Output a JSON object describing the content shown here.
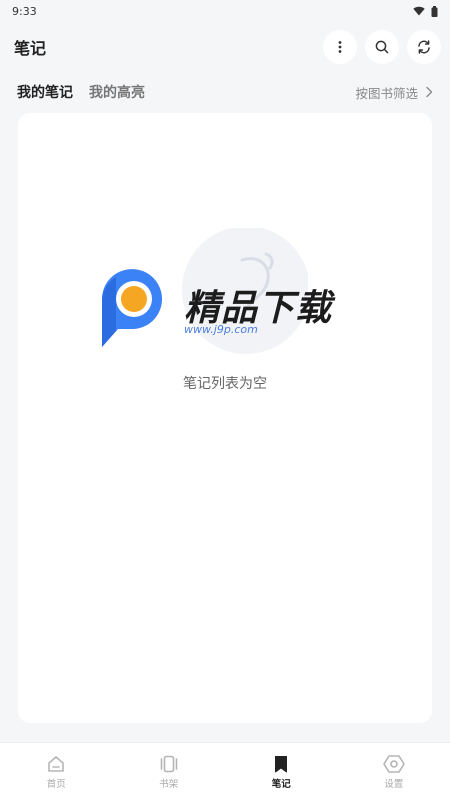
{
  "status_bar": {
    "time": "9:33"
  },
  "header": {
    "title": "笔记"
  },
  "tabs": [
    {
      "label": "我的笔记",
      "active": true
    },
    {
      "label": "我的高亮",
      "active": false
    }
  ],
  "filter": {
    "label": "按图书筛选"
  },
  "empty": {
    "message": "笔记列表为空"
  },
  "watermark": {
    "text": "精品下载",
    "url": "www.j9p.com"
  },
  "bottom_nav": [
    {
      "label": "首页",
      "icon": "home-icon",
      "active": false
    },
    {
      "label": "书架",
      "icon": "bookshelf-icon",
      "active": false
    },
    {
      "label": "笔记",
      "icon": "bookmark-icon",
      "active": true
    },
    {
      "label": "设置",
      "icon": "settings-icon",
      "active": false
    }
  ],
  "colors": {
    "background": "#f5f6f8",
    "card": "#ffffff",
    "active_text": "#222222",
    "inactive_text": "#aaaaaa",
    "watermark_blue": "#3b82f6",
    "watermark_orange": "#f5a623"
  }
}
